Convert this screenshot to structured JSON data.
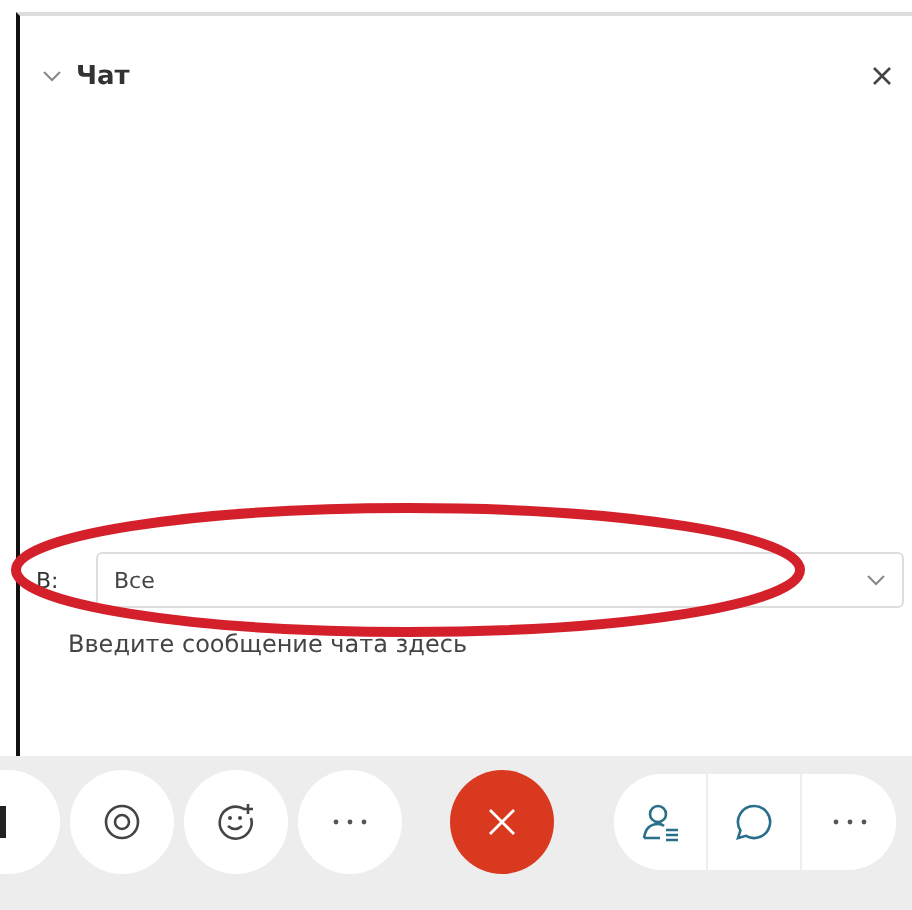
{
  "chat_panel": {
    "title": "Чат",
    "expanded": true
  },
  "recipient": {
    "label": "В:",
    "value": "Все"
  },
  "message": {
    "placeholder": "Введите сообщение чата здесь"
  },
  "annotation": {
    "kind": "ellipse"
  },
  "toolbar": {
    "buttons": [
      {
        "kind": "partial"
      },
      {
        "kind": "record"
      },
      {
        "kind": "reaction"
      },
      {
        "kind": "more"
      },
      {
        "kind": "end-call"
      }
    ],
    "group": [
      {
        "kind": "participants"
      },
      {
        "kind": "chat"
      },
      {
        "kind": "more"
      }
    ]
  }
}
